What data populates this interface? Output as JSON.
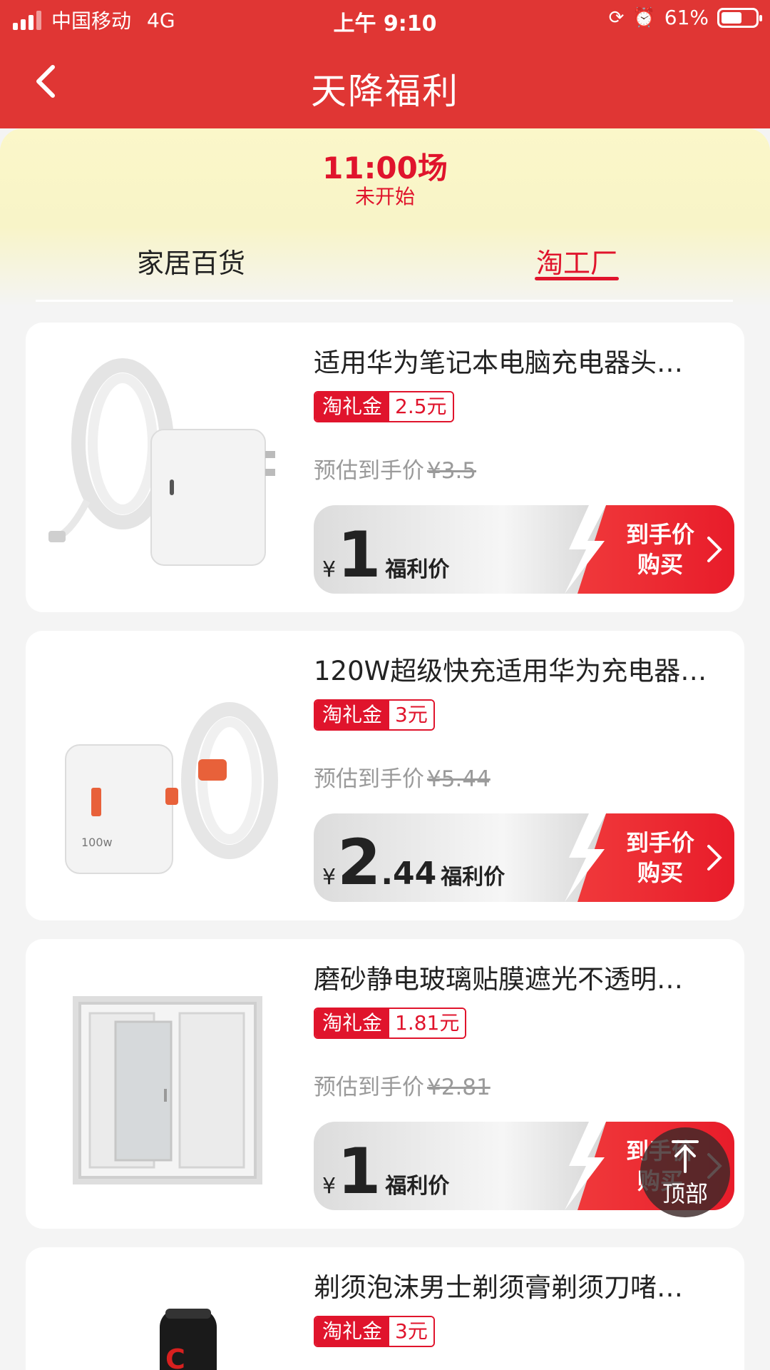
{
  "status_bar": {
    "carrier": "中国移动",
    "network": "4G",
    "time": "上午 9:10",
    "battery": "61%"
  },
  "nav": {
    "title": "天降福利"
  },
  "session": {
    "time": "11:00场",
    "status": "未开始"
  },
  "tabs": [
    {
      "label": "家居百货",
      "active": false
    },
    {
      "label": "淘工厂",
      "active": true
    }
  ],
  "coupon_label": "淘礼金",
  "est_label": "预估到手价",
  "price_tag": "福利价",
  "buy_line1": "到手价",
  "buy_line2": "购买",
  "currency": "¥",
  "products": [
    {
      "title": "适用华为笔记本电脑充电器头…",
      "coupon": "2.5元",
      "orig": "¥3.5",
      "price_int": "1",
      "price_dec": ""
    },
    {
      "title": "120W超级快充适用华为充电器…",
      "coupon": "3元",
      "orig": "¥5.44",
      "price_int": "2",
      "price_dec": ".44"
    },
    {
      "title": "磨砂静电玻璃贴膜遮光不透明…",
      "coupon": "1.81元",
      "orig": "¥2.81",
      "price_int": "1",
      "price_dec": ""
    },
    {
      "title": "剃须泡沫男士剃须膏剃须刀啫…",
      "coupon": "3元"
    }
  ],
  "back_to_top": "顶部",
  "colors": {
    "brand_red": "#e03634",
    "accent_red": "#e0142c"
  }
}
